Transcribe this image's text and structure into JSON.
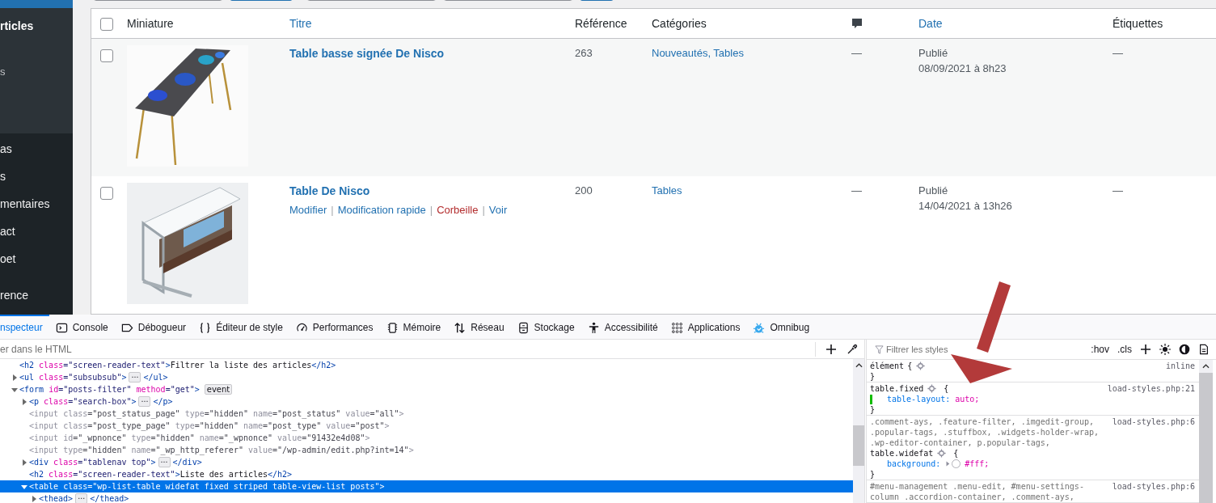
{
  "sidebar": {
    "submenu": [
      {
        "label": "rticles",
        "kind": "heading"
      },
      {
        "label": "s",
        "kind": "item"
      }
    ],
    "items": [
      {
        "label": "as"
      },
      {
        "label": "s"
      },
      {
        "label": "mentaires"
      },
      {
        "label": "act"
      },
      {
        "label": "oet"
      },
      {
        "label": "rence"
      }
    ]
  },
  "tablenav": [
    {
      "kind": "field"
    },
    {
      "kind": "button"
    },
    {
      "kind": "field"
    },
    {
      "kind": "field"
    },
    {
      "kind": "button"
    }
  ],
  "table": {
    "select_all": {
      "checked": false
    },
    "columns": [
      {
        "kind": "text",
        "label": "Miniature",
        "sortable": false
      },
      {
        "kind": "text",
        "label": "Titre",
        "sortable": true
      },
      {
        "kind": "text",
        "label": "Référence",
        "sortable": false
      },
      {
        "kind": "text",
        "label": "Catégories",
        "sortable": false
      },
      {
        "kind": "icon"
      },
      {
        "kind": "text",
        "label": "Date",
        "sortable": true
      },
      {
        "kind": "text",
        "label": "Étiquettes",
        "sortable": false
      }
    ],
    "rows": [
      {
        "checked": false,
        "thumbnail": {
          "kind": "picture"
        },
        "title": "Table basse signée De Nisco",
        "reference": "263",
        "categories": "Nouveautés, Tables",
        "comments": "—",
        "status": "Publié",
        "date": "08/09/2021 à 8h23",
        "tags": "—"
      },
      {
        "checked": false,
        "thumbnail": {
          "kind": "picture"
        },
        "title": "Table De Nisco",
        "actions": [
          {
            "label": "Modifier",
            "kind": "normal"
          },
          {
            "label": "Modification rapide",
            "kind": "normal"
          },
          {
            "label": "Corbeille",
            "kind": "delete"
          },
          {
            "label": "Voir",
            "kind": "normal"
          }
        ],
        "action_separator": "|",
        "reference": "200",
        "categories": "Tables",
        "comments": "—",
        "status": "Publié",
        "date": "14/04/2021 à 13h26",
        "tags": "—"
      }
    ]
  },
  "devtools": {
    "tabs": [
      {
        "label": "nspecteur",
        "selected": true
      },
      {
        "label": "Console",
        "selected": false
      },
      {
        "label": "Débogueur",
        "selected": false
      },
      {
        "label": "Éditeur de style",
        "selected": false
      },
      {
        "label": "Performances",
        "selected": false
      },
      {
        "label": "Mémoire",
        "selected": false
      },
      {
        "label": "Réseau",
        "selected": false
      },
      {
        "label": "Stockage",
        "selected": false
      },
      {
        "label": "Accessibilité",
        "selected": false
      },
      {
        "label": "Applications",
        "selected": false
      },
      {
        "label": "Omnibug",
        "selected": false
      }
    ],
    "html_search": {
      "placeholder": "er dans le HTML"
    },
    "tree": [
      {
        "selected": false,
        "dimmed": false,
        "segments": [
          {
            "kind": "code",
            "tokens": [
              {
                "kind": "tag",
                "text": "<h2"
              },
              {
                "kind": "attr",
                "text": " class"
              },
              {
                "kind": "value",
                "text": "=\"screen-reader-text\""
              },
              {
                "kind": "tag",
                "text": ">"
              },
              {
                "kind": "text",
                "text": "Filtrer la liste des articles"
              },
              {
                "kind": "tag",
                "text": "</h2>"
              }
            ]
          }
        ]
      },
      {
        "expanded": false,
        "selected": false,
        "dimmed": false,
        "segments": [
          {
            "kind": "code",
            "tokens": [
              {
                "kind": "tag",
                "text": "<ul"
              },
              {
                "kind": "attr",
                "text": " class"
              },
              {
                "kind": "value",
                "text": "=\"subsubsub\""
              },
              {
                "kind": "tag",
                "text": ">"
              }
            ]
          },
          {
            "kind": "more",
            "text": "⋯"
          },
          {
            "kind": "code",
            "tokens": [
              {
                "kind": "tag",
                "text": "</ul>"
              }
            ]
          }
        ]
      },
      {
        "expanded": true,
        "selected": false,
        "dimmed": false,
        "segments": [
          {
            "kind": "code",
            "tokens": [
              {
                "kind": "tag",
                "text": "<form"
              },
              {
                "kind": "attr",
                "text": " id"
              },
              {
                "kind": "value",
                "text": "=\"posts-filter\""
              },
              {
                "kind": "attr",
                "text": " method"
              },
              {
                "kind": "value",
                "text": "=\"get\""
              },
              {
                "kind": "tag",
                "text": ">"
              }
            ]
          },
          {
            "kind": "event",
            "text": "event"
          }
        ],
        "children": [
          {
            "expanded": false,
            "selected": false,
            "dimmed": false,
            "segments": [
              {
                "kind": "code",
                "tokens": [
                  {
                    "kind": "tag",
                    "text": "<p"
                  },
                  {
                    "kind": "attr",
                    "text": " class"
                  },
                  {
                    "kind": "value",
                    "text": "=\"search-box\""
                  },
                  {
                    "kind": "tag",
                    "text": ">"
                  }
                ]
              },
              {
                "kind": "more",
                "text": "⋯"
              },
              {
                "kind": "code",
                "tokens": [
                  {
                    "kind": "tag",
                    "text": "</p>"
                  }
                ]
              }
            ]
          },
          {
            "selected": false,
            "dimmed": true,
            "segments": [
              {
                "kind": "code",
                "tokens": [
                  {
                    "kind": "tag",
                    "text": "<input"
                  },
                  {
                    "kind": "attr",
                    "text": " class"
                  },
                  {
                    "kind": "value",
                    "text": "=\"post_status_page\""
                  },
                  {
                    "kind": "attr",
                    "text": " type"
                  },
                  {
                    "kind": "value",
                    "text": "=\"hidden\""
                  },
                  {
                    "kind": "attr",
                    "text": " name"
                  },
                  {
                    "kind": "value",
                    "text": "=\"post_status\""
                  },
                  {
                    "kind": "attr",
                    "text": " value"
                  },
                  {
                    "kind": "value",
                    "text": "=\"all\""
                  },
                  {
                    "kind": "tag",
                    "text": ">"
                  }
                ]
              }
            ]
          },
          {
            "selected": false,
            "dimmed": true,
            "segments": [
              {
                "kind": "code",
                "tokens": [
                  {
                    "kind": "tag",
                    "text": "<input"
                  },
                  {
                    "kind": "attr",
                    "text": " class"
                  },
                  {
                    "kind": "value",
                    "text": "=\"post_type_page\""
                  },
                  {
                    "kind": "attr",
                    "text": " type"
                  },
                  {
                    "kind": "value",
                    "text": "=\"hidden\""
                  },
                  {
                    "kind": "attr",
                    "text": " name"
                  },
                  {
                    "kind": "value",
                    "text": "=\"post_type\""
                  },
                  {
                    "kind": "attr",
                    "text": " value"
                  },
                  {
                    "kind": "value",
                    "text": "=\"post\""
                  },
                  {
                    "kind": "tag",
                    "text": ">"
                  }
                ]
              }
            ]
          },
          {
            "selected": false,
            "dimmed": true,
            "segments": [
              {
                "kind": "code",
                "tokens": [
                  {
                    "kind": "tag",
                    "text": "<input"
                  },
                  {
                    "kind": "attr",
                    "text": " id"
                  },
                  {
                    "kind": "value",
                    "text": "=\"_wpnonce\""
                  },
                  {
                    "kind": "attr",
                    "text": " type"
                  },
                  {
                    "kind": "value",
                    "text": "=\"hidden\""
                  },
                  {
                    "kind": "attr",
                    "text": " name"
                  },
                  {
                    "kind": "value",
                    "text": "=\"_wpnonce\""
                  },
                  {
                    "kind": "attr",
                    "text": " value"
                  },
                  {
                    "kind": "value",
                    "text": "=\"91432e4d08\""
                  },
                  {
                    "kind": "tag",
                    "text": ">"
                  }
                ]
              }
            ]
          },
          {
            "selected": false,
            "dimmed": true,
            "segments": [
              {
                "kind": "code",
                "tokens": [
                  {
                    "kind": "tag",
                    "text": "<input"
                  },
                  {
                    "kind": "attr",
                    "text": " type"
                  },
                  {
                    "kind": "value",
                    "text": "=\"hidden\""
                  },
                  {
                    "kind": "attr",
                    "text": " name"
                  },
                  {
                    "kind": "value",
                    "text": "=\"_wp_http_referer\""
                  },
                  {
                    "kind": "attr",
                    "text": " value"
                  },
                  {
                    "kind": "value",
                    "text": "=\"/wp-admin/edit.php?int=14\""
                  },
                  {
                    "kind": "tag",
                    "text": ">"
                  }
                ]
              }
            ]
          },
          {
            "expanded": false,
            "selected": false,
            "dimmed": false,
            "segments": [
              {
                "kind": "code",
                "tokens": [
                  {
                    "kind": "tag",
                    "text": "<div"
                  },
                  {
                    "kind": "attr",
                    "text": " class"
                  },
                  {
                    "kind": "value",
                    "text": "=\"tablenav top\""
                  },
                  {
                    "kind": "tag",
                    "text": ">"
                  }
                ]
              },
              {
                "kind": "more",
                "text": "⋯"
              },
              {
                "kind": "code",
                "tokens": [
                  {
                    "kind": "tag",
                    "text": "</div>"
                  }
                ]
              }
            ]
          },
          {
            "selected": false,
            "dimmed": false,
            "segments": [
              {
                "kind": "code",
                "tokens": [
                  {
                    "kind": "tag",
                    "text": "<h2"
                  },
                  {
                    "kind": "attr",
                    "text": " class"
                  },
                  {
                    "kind": "value",
                    "text": "=\"screen-reader-text\""
                  },
                  {
                    "kind": "tag",
                    "text": ">"
                  },
                  {
                    "kind": "text",
                    "text": "Liste des articles"
                  },
                  {
                    "kind": "tag",
                    "text": "</h2>"
                  }
                ]
              }
            ]
          },
          {
            "expanded": true,
            "selected": true,
            "dimmed": false,
            "segments": [
              {
                "kind": "code",
                "tokens": [
                  {
                    "kind": "tag",
                    "text": "<table"
                  },
                  {
                    "kind": "attr",
                    "text": " class"
                  },
                  {
                    "kind": "value",
                    "text": "=\"wp-list-table widefat fixed striped table-view-list posts\""
                  },
                  {
                    "kind": "tag",
                    "text": ">"
                  }
                ]
              }
            ],
            "children": [
              {
                "expanded": false,
                "selected": false,
                "dimmed": false,
                "segments": [
                  {
                    "kind": "code",
                    "tokens": [
                      {
                        "kind": "tag",
                        "text": "<thead>"
                      }
                    ]
                  },
                  {
                    "kind": "more",
                    "text": "⋯"
                  },
                  {
                    "kind": "code",
                    "tokens": [
                      {
                        "kind": "tag",
                        "text": "</thead>"
                      }
                    ]
                  }
                ]
              }
            ]
          }
        ]
      }
    ],
    "rules_filter": {
      "placeholder": "Filtrer les styles"
    },
    "rule_toggles": [
      {
        "label": ":hov"
      },
      {
        "label": ".cls"
      }
    ],
    "rules": [
      {
        "kind": "inline",
        "selector": [
          {
            "text": "élément",
            "matched": true
          }
        ],
        "gear": true,
        "opening": "{",
        "closing": "}",
        "source": "inline"
      },
      {
        "kind": "stylesheet",
        "selector": [
          {
            "text": "table.fixed",
            "matched": true
          }
        ],
        "gear": true,
        "opening": "{",
        "closing": "}",
        "source": "load-styles.php:21",
        "declarations": [
          {
            "property": "table-layout:",
            "value": "auto;",
            "changed": true,
            "expandable": false
          }
        ]
      },
      {
        "kind": "stylesheet",
        "selector": [
          {
            "text": ".comment-ays, .feature-filter, .imgedit-group, .popular-tags, .stuffbox, .widgets-holder-wrap, .wp-editor-container, p.popular-tags,",
            "matched": false
          },
          {
            "text": "table.widefat",
            "matched": true
          }
        ],
        "gear": true,
        "opening": "{",
        "closing": "}",
        "source": "load-styles.php:6",
        "declarations": [
          {
            "property": "background:",
            "value": "#fff;",
            "changed": false,
            "expandable": true,
            "color": "#ffffff"
          }
        ]
      },
      {
        "kind": "stylesheet",
        "selector": [
          {
            "text": "#menu-management .menu-edit, #menu-settings-column .accordion-container, .comment-ays,",
            "matched": false
          }
        ],
        "gear": false,
        "source": "load-styles.php:6"
      }
    ]
  }
}
